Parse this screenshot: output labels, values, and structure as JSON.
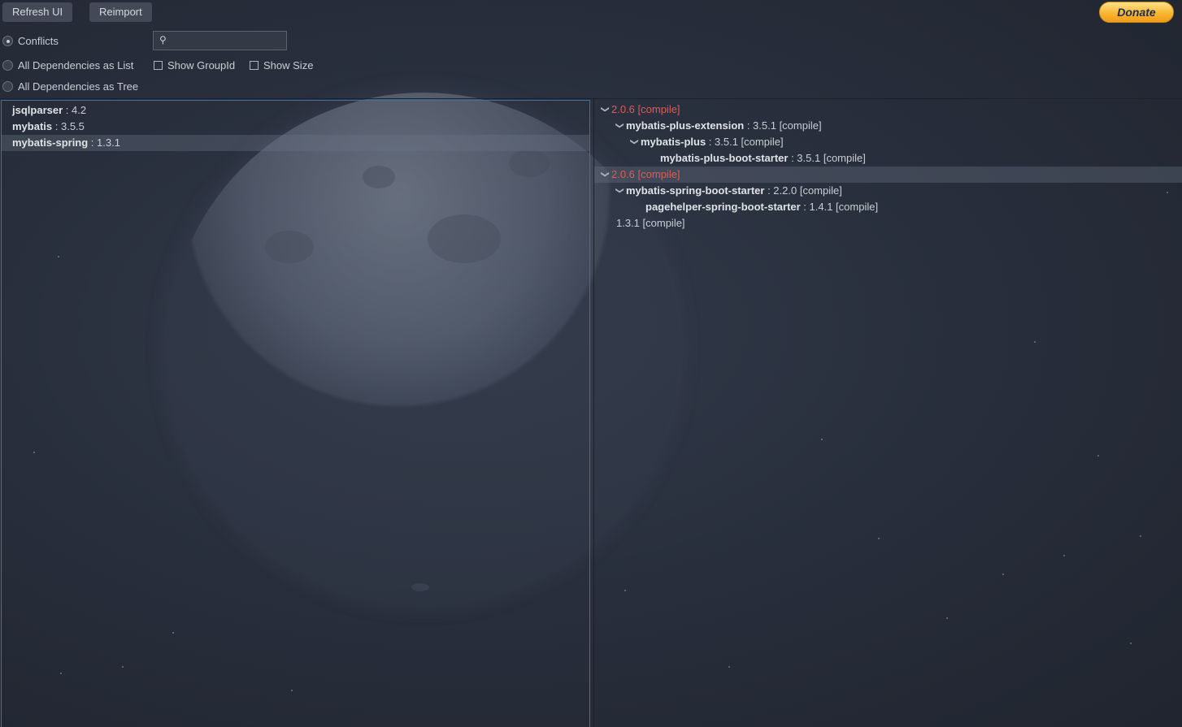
{
  "toolbar": {
    "refresh_label": "Refresh UI",
    "reimport_label": "Reimport",
    "donate_label": "Donate"
  },
  "modes": {
    "conflicts": "Conflicts",
    "list": "All Dependencies as List",
    "tree": "All Dependencies as Tree",
    "selected": "conflicts"
  },
  "options": {
    "show_group_id": "Show GroupId",
    "show_size": "Show Size"
  },
  "search": {
    "value": "",
    "placeholder": ""
  },
  "left_list": [
    {
      "name": "jsqlparser",
      "version": " : 4.2"
    },
    {
      "name": "mybatis",
      "version": " : 3.5.5"
    },
    {
      "name": "mybatis-spring",
      "version": " : 1.3.1",
      "selected": true
    }
  ],
  "right_tree": [
    {
      "label": "2.0.6 [compile]",
      "red": true
    },
    {
      "name": "mybatis-plus-extension",
      "version": " : 3.5.1 [compile]"
    },
    {
      "name": "mybatis-plus",
      "version": " : 3.5.1 [compile]"
    },
    {
      "name": "mybatis-plus-boot-starter",
      "version": " : 3.5.1 [compile]"
    },
    {
      "label": "2.0.6 [compile]",
      "red": true
    },
    {
      "name": "mybatis-spring-boot-starter",
      "version": " : 2.2.0 [compile]"
    },
    {
      "name": "pagehelper-spring-boot-starter",
      "version": " : 1.4.1 [compile]"
    },
    {
      "label": "1.3.1 [compile]"
    }
  ],
  "colors": {
    "accent_border": "#3f6fa3",
    "conflict_red": "#e05a55",
    "donate_gold": "#f7b733"
  }
}
